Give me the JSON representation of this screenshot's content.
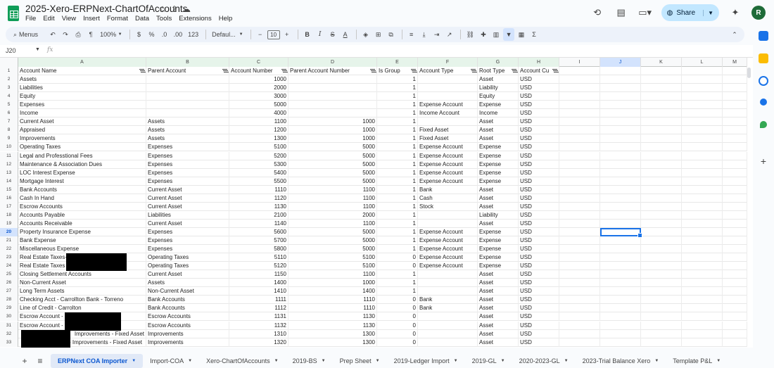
{
  "title": "2025-Xero-ERPNext-ChartOfAccounts",
  "menu": [
    "File",
    "Edit",
    "View",
    "Insert",
    "Format",
    "Data",
    "Tools",
    "Extensions",
    "Help"
  ],
  "share_label": "Share",
  "avatar_initial": "R",
  "toolbar": {
    "menus_label": "Menus",
    "zoom": "100%",
    "currency": "$",
    "percent": "%",
    "dec_decrease": ".0",
    "dec_increase": ".00",
    "number_format": "123",
    "font": "Defaul...",
    "font_size": "10"
  },
  "name_box": "J20",
  "fx_label": "fx",
  "columns": [
    "A",
    "B",
    "C",
    "D",
    "E",
    "F",
    "G",
    "H",
    "I",
    "J",
    "K",
    "L",
    "M"
  ],
  "headers": [
    "Account Name",
    "Parent Account",
    "Account Number",
    "Parent Account Number",
    "Is Group",
    "Account Type",
    "Root Type",
    "Account Cu"
  ],
  "rows": [
    [
      "Assets",
      "",
      "1000",
      "",
      "1",
      "",
      "Asset",
      "USD"
    ],
    [
      "Liabilities",
      "",
      "2000",
      "",
      "1",
      "",
      "Liability",
      "USD"
    ],
    [
      "Equity",
      "",
      "3000",
      "",
      "1",
      "",
      "Equity",
      "USD"
    ],
    [
      "Expenses",
      "",
      "5000",
      "",
      "1",
      "Expense Account",
      "Expense",
      "USD"
    ],
    [
      "Income",
      "",
      "4000",
      "",
      "1",
      "Income Account",
      "Income",
      "USD"
    ],
    [
      "Current Asset",
      "Assets",
      "1100",
      "1000",
      "1",
      "",
      "Asset",
      "USD"
    ],
    [
      "Appraised",
      "Assets",
      "1200",
      "1000",
      "1",
      "Fixed Asset",
      "Asset",
      "USD"
    ],
    [
      "Improvements",
      "Assets",
      "1300",
      "1000",
      "1",
      "Fixed Asset",
      "Asset",
      "USD"
    ],
    [
      "Operating Taxes",
      "Expenses",
      "5100",
      "5000",
      "1",
      "Expense Account",
      "Expense",
      "USD"
    ],
    [
      "Legal and Professtional Fees",
      "Expenses",
      "5200",
      "5000",
      "1",
      "Expense Account",
      "Expense",
      "USD"
    ],
    [
      "Maintenance & Association Dues",
      "Expenses",
      "5300",
      "5000",
      "1",
      "Expense Account",
      "Expense",
      "USD"
    ],
    [
      "LOC Interest Expense",
      "Expenses",
      "5400",
      "5000",
      "1",
      "Expense Account",
      "Expense",
      "USD"
    ],
    [
      "Mortgage Interest",
      "Expenses",
      "5500",
      "5000",
      "1",
      "Expense Account",
      "Expense",
      "USD"
    ],
    [
      "Bank Accounts",
      "Current Asset",
      "1110",
      "1100",
      "1",
      "Bank",
      "Asset",
      "USD"
    ],
    [
      "Cash In Hand",
      "Current Asset",
      "1120",
      "1100",
      "1",
      "Cash",
      "Asset",
      "USD"
    ],
    [
      "Escrow Accounts",
      "Current Asset",
      "1130",
      "1100",
      "1",
      "Stock",
      "Asset",
      "USD"
    ],
    [
      "Accounts Payable",
      "Liabilities",
      "2100",
      "2000",
      "1",
      "",
      "Liability",
      "USD"
    ],
    [
      "Accounts Receivable",
      "Current Asset",
      "1140",
      "1100",
      "1",
      "",
      "Asset",
      "USD"
    ],
    [
      "Property Insurance Expense",
      "Expenses",
      "5600",
      "5000",
      "1",
      "Expense Account",
      "Expense",
      "USD"
    ],
    [
      "Bank Expense",
      "Expenses",
      "5700",
      "5000",
      "1",
      "Expense Account",
      "Expense",
      "USD"
    ],
    [
      "Miscellaneous Expense",
      "Expenses",
      "5800",
      "5000",
      "1",
      "Expense Account",
      "Expense",
      "USD"
    ],
    [
      "Real Estate Taxes-",
      "Operating Taxes",
      "5110",
      "5100",
      "0",
      "Expense Account",
      "Expense",
      "USD"
    ],
    [
      "Real Estate Taxes",
      "Operating Taxes",
      "5120",
      "5100",
      "0",
      "Expense Account",
      "Expense",
      "USD"
    ],
    [
      "Closing Settlement Accounts",
      "Current Asset",
      "1150",
      "1100",
      "1",
      "",
      "Asset",
      "USD"
    ],
    [
      "Non-Current Asset",
      "Assets",
      "1400",
      "1000",
      "1",
      "",
      "Asset",
      "USD"
    ],
    [
      "Long Term Assets",
      "Non-Current Asset",
      "1410",
      "1400",
      "1",
      "",
      "Asset",
      "USD"
    ],
    [
      "Checking Acct - Carrollton Bank - Torreno",
      "Bank Accounts",
      "1111",
      "1110",
      "0",
      "Bank",
      "Asset",
      "USD"
    ],
    [
      "Line of Credit - Carrolton",
      "Bank Accounts",
      "1112",
      "1110",
      "0",
      "Bank",
      "Asset",
      "USD"
    ],
    [
      "Escrow Account - T",
      "Escrow Accounts",
      "1131",
      "1130",
      "0",
      "",
      "Asset",
      "USD"
    ],
    [
      "Escrow Account - T",
      "Escrow Accounts",
      "1132",
      "1130",
      "0",
      "",
      "Asset",
      "USD"
    ],
    [
      "Improvements - Fixed Asset",
      "Improvements",
      "1310",
      "1300",
      "0",
      "",
      "Asset",
      "USD"
    ],
    [
      "- Improvements - Fixed Asset",
      "Improvements",
      "1320",
      "1300",
      "0",
      "",
      "Asset",
      "USD"
    ]
  ],
  "sheet_tabs": [
    "ERPNext COA Importer",
    "Import-COA",
    "Xero-ChartOfAccounts",
    "2019-BS",
    "Prep Sheet",
    "2019-Ledger Import",
    "2019-GL",
    "2020-2023-GL",
    "2023-Trial Balance Xero",
    "Template P&L"
  ],
  "active_tab": "ERPNext COA Importer",
  "colors": {
    "accent": "#1a73e8",
    "share_bg": "#c2e7ff",
    "sheets_green": "#0f9d58",
    "avatar": "#1e6b38"
  }
}
